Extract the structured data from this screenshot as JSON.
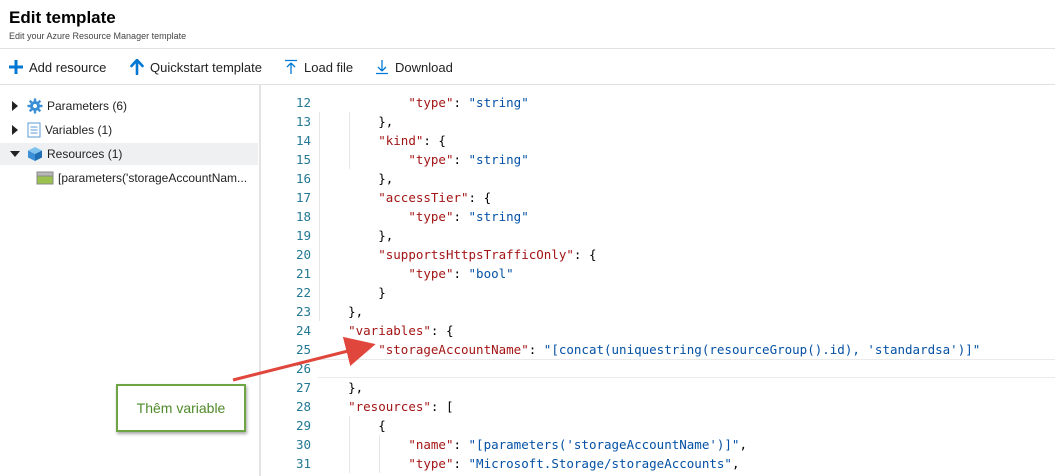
{
  "header": {
    "title": "Edit template",
    "subtitle": "Edit your Azure Resource Manager template"
  },
  "toolbar": {
    "add_resource": "Add resource",
    "quickstart_template": "Quickstart template",
    "load_file": "Load file",
    "download": "Download"
  },
  "tree": {
    "items": [
      {
        "label": "Parameters (6)",
        "icon": "gear-icon"
      },
      {
        "label": "Variables (1)",
        "icon": "document-icon"
      },
      {
        "label": "Resources (1)",
        "icon": "cube-icon"
      },
      {
        "label": "[parameters('storageAccountNam...",
        "icon": "storage-icon"
      }
    ]
  },
  "editor": {
    "line_numbers": [
      "12",
      "13",
      "14",
      "15",
      "16",
      "17",
      "18",
      "19",
      "20",
      "21",
      "22",
      "23",
      "24",
      "25",
      "26",
      "27",
      "28",
      "29",
      "30",
      "31"
    ],
    "lines": [
      [
        {
          "t": "            "
        },
        {
          "t": "\"type\"",
          "c": "key"
        },
        {
          "t": ": "
        },
        {
          "t": "\"string\"",
          "c": "str"
        }
      ],
      [
        {
          "t": "        },"
        }
      ],
      [
        {
          "t": "        "
        },
        {
          "t": "\"kind\"",
          "c": "key"
        },
        {
          "t": ": {"
        }
      ],
      [
        {
          "t": "            "
        },
        {
          "t": "\"type\"",
          "c": "key"
        },
        {
          "t": ": "
        },
        {
          "t": "\"string\"",
          "c": "str"
        }
      ],
      [
        {
          "t": "        },"
        }
      ],
      [
        {
          "t": "        "
        },
        {
          "t": "\"accessTier\"",
          "c": "key"
        },
        {
          "t": ": {"
        }
      ],
      [
        {
          "t": "            "
        },
        {
          "t": "\"type\"",
          "c": "key"
        },
        {
          "t": ": "
        },
        {
          "t": "\"string\"",
          "c": "str"
        }
      ],
      [
        {
          "t": "        },"
        }
      ],
      [
        {
          "t": "        "
        },
        {
          "t": "\"supportsHttpsTrafficOnly\"",
          "c": "key"
        },
        {
          "t": ": {"
        }
      ],
      [
        {
          "t": "            "
        },
        {
          "t": "\"type\"",
          "c": "key"
        },
        {
          "t": ": "
        },
        {
          "t": "\"bool\"",
          "c": "str"
        }
      ],
      [
        {
          "t": "        }"
        }
      ],
      [
        {
          "t": "    },"
        }
      ],
      [
        {
          "t": "    "
        },
        {
          "t": "\"variables\"",
          "c": "key"
        },
        {
          "t": ": {"
        }
      ],
      [
        {
          "t": "        "
        },
        {
          "t": "\"storageAccountName\"",
          "c": "key"
        },
        {
          "t": ": "
        },
        {
          "t": "\"[concat(uniquestring(resourceGroup().id), 'standardsa')]\"",
          "c": "str"
        }
      ],
      [
        {
          "t": ""
        }
      ],
      [
        {
          "t": "    },"
        }
      ],
      [
        {
          "t": "    "
        },
        {
          "t": "\"resources\"",
          "c": "key"
        },
        {
          "t": ": ["
        }
      ],
      [
        {
          "t": "        {"
        }
      ],
      [
        {
          "t": "            "
        },
        {
          "t": "\"name\"",
          "c": "key"
        },
        {
          "t": ": "
        },
        {
          "t": "\"[parameters('storageAccountName')]\"",
          "c": "str"
        },
        {
          "t": ","
        }
      ],
      [
        {
          "t": "            "
        },
        {
          "t": "\"type\"",
          "c": "key"
        },
        {
          "t": ": "
        },
        {
          "t": "\"Microsoft.Storage/storageAccounts\"",
          "c": "str"
        },
        {
          "t": ","
        }
      ]
    ],
    "cursor_line": "26"
  },
  "callout": {
    "text": "Thêm variable"
  },
  "colors": {
    "key": "#a31515",
    "string": "#0451a5",
    "punct": "#000000",
    "line_number": "#237893",
    "callout_border": "#6ea544",
    "callout_text": "#4f8a2a",
    "arrow": "#e0463c",
    "accent": "#0078d4"
  }
}
